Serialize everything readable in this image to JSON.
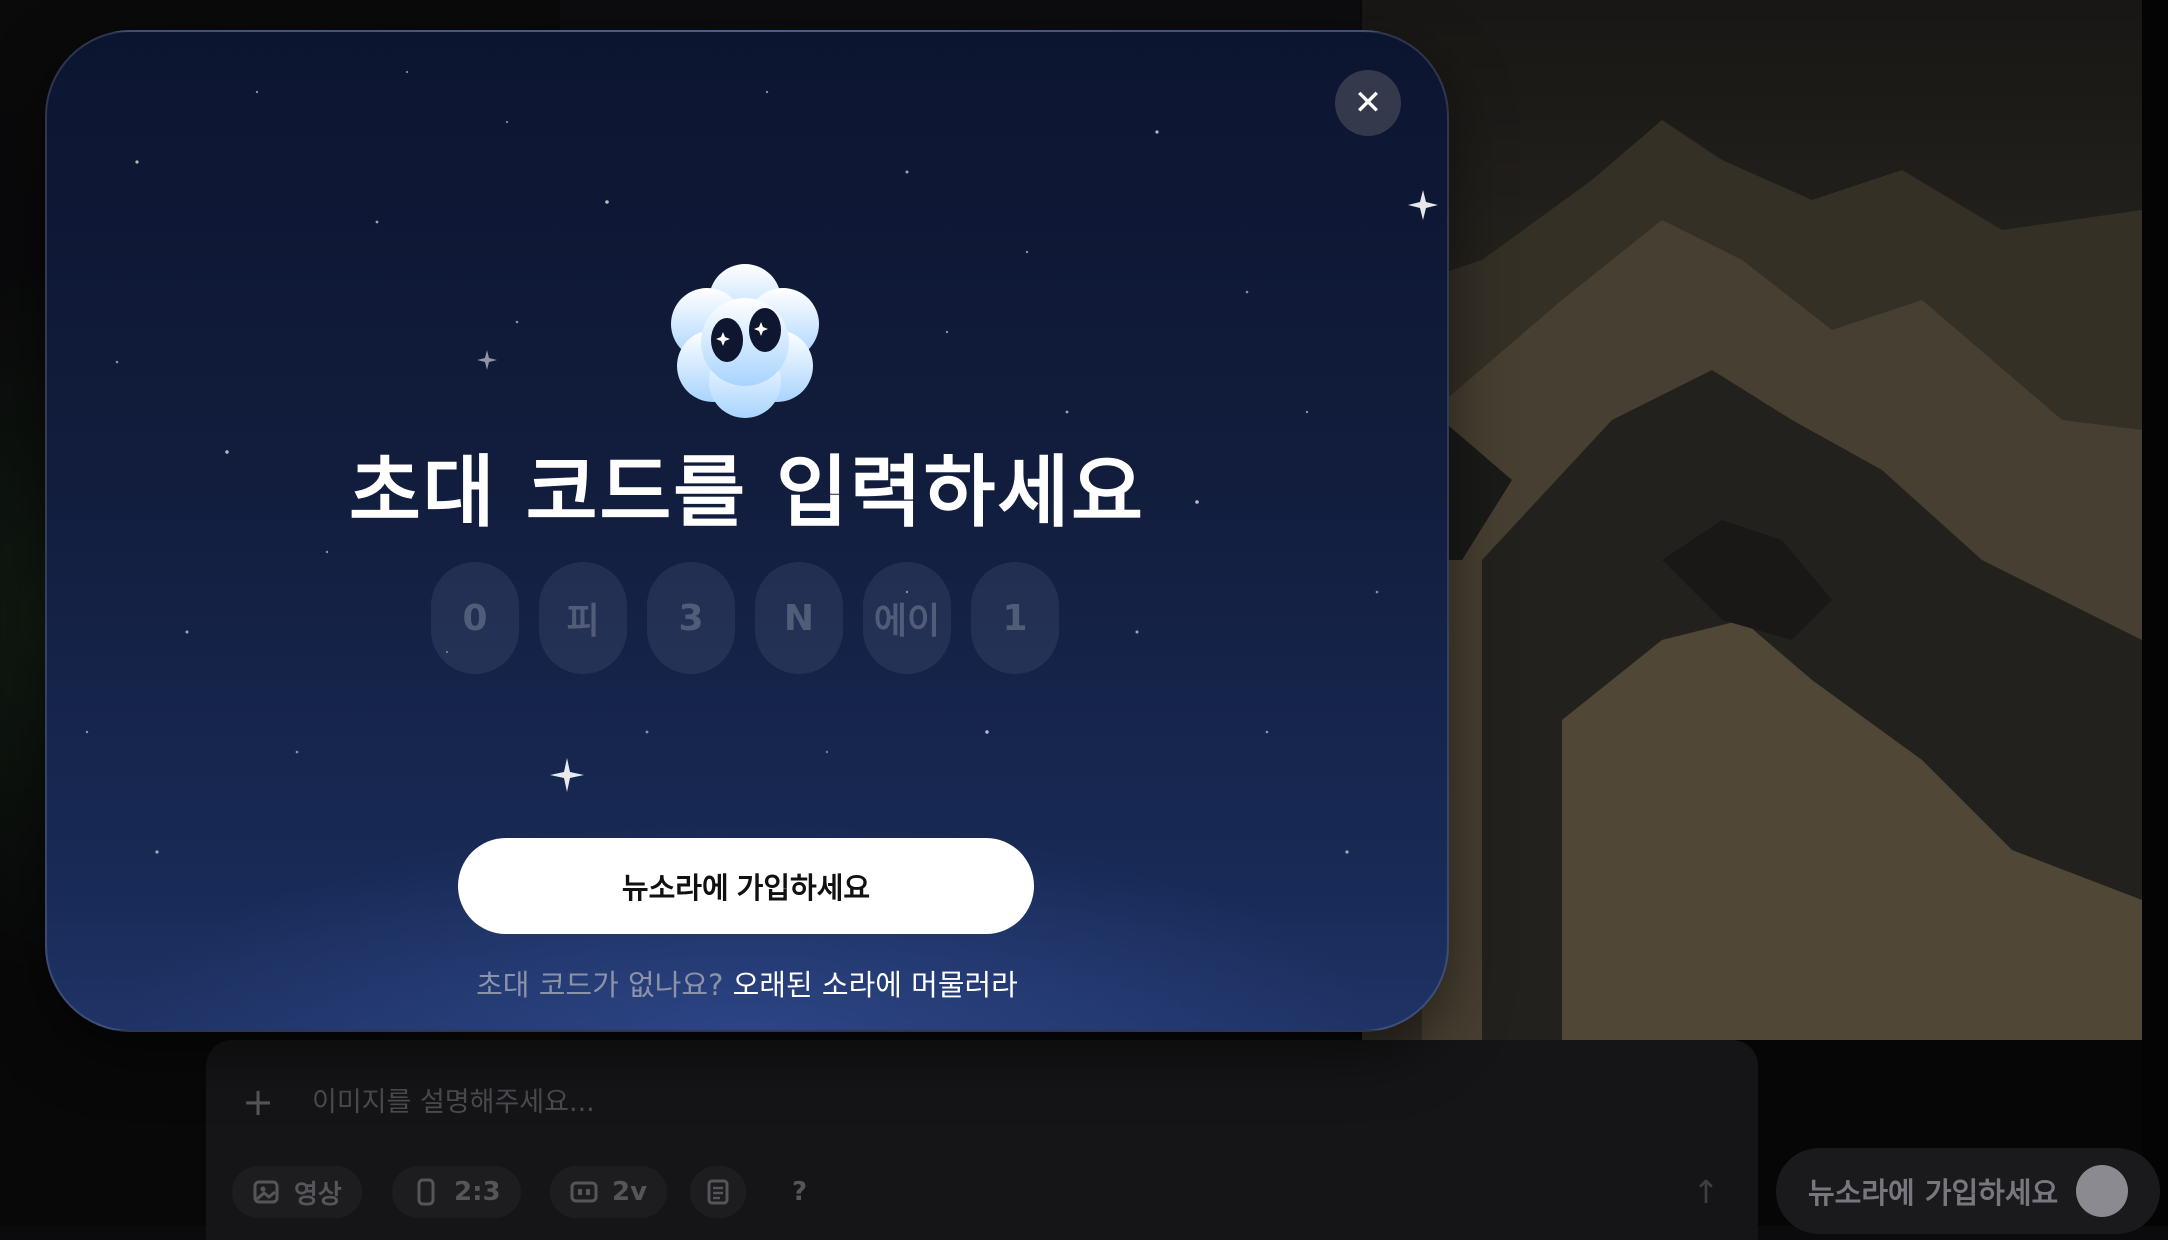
{
  "modal": {
    "title": "초대 코드를 입력하세요",
    "code_chars": [
      "0",
      "피",
      "3",
      "N",
      "에이",
      "1"
    ],
    "cta_label": "뉴소라에 가입하세요",
    "footer_question": "초대 코드가 없나요?",
    "footer_link": "오래된 소라에 머물러라",
    "close_glyph": "✕"
  },
  "prompt_bar": {
    "placeholder": "이미지를 설명해주세요...",
    "plus_glyph": "+",
    "chips": {
      "media": "영상",
      "aspect": "2:3",
      "variations": "2v",
      "help": "?"
    },
    "send_glyph": "↑"
  },
  "signup_pill": {
    "label": "뉴소라에 가입하세요"
  },
  "colors": {
    "modal_bg": "#121d3d",
    "cta_bg": "#ffffff",
    "link": "#ffffff"
  },
  "icons": [
    "close-icon",
    "mascot-icon",
    "plus-icon",
    "image-icon",
    "phone-icon",
    "grid-icon",
    "list-icon",
    "help-icon",
    "send-icon"
  ]
}
